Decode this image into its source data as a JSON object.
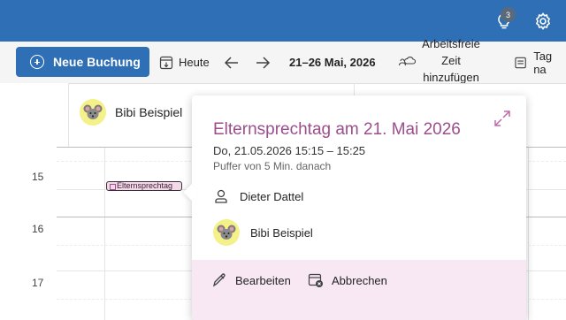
{
  "topbar": {
    "notifications_count": "3",
    "icons": [
      "lightbulb-icon",
      "gear-icon"
    ],
    "color": "#2f6fb6"
  },
  "toolbar": {
    "new_booking_label": "Neue Buchung",
    "today_label": "Heute",
    "date_range": "21–26 Mai, 2026",
    "free_time_line1": "Arbeitsfreie",
    "free_time_line2": "Zeit",
    "free_time_line3": "hinzufügen",
    "day_view_label": "Tag na"
  },
  "calendar": {
    "person_name": "Bibi Beispiel",
    "times": [
      "15",
      "16",
      "17"
    ]
  },
  "event_chip": {
    "label": "Elternsprechtag"
  },
  "popup": {
    "title": "Elternsprechtag am 21. Mai 2026",
    "datetime": "Do, 21.05.2026 15:15 – 15:25",
    "buffer": "Puffer von 5 Min. danach",
    "organizer": "Dieter Dattel",
    "attendee": "Bibi Beispiel",
    "edit_label": "Bearbeiten",
    "cancel_label": "Abbrechen",
    "accent_color": "#9b4d8c",
    "footer_color": "#f8e8f3"
  }
}
